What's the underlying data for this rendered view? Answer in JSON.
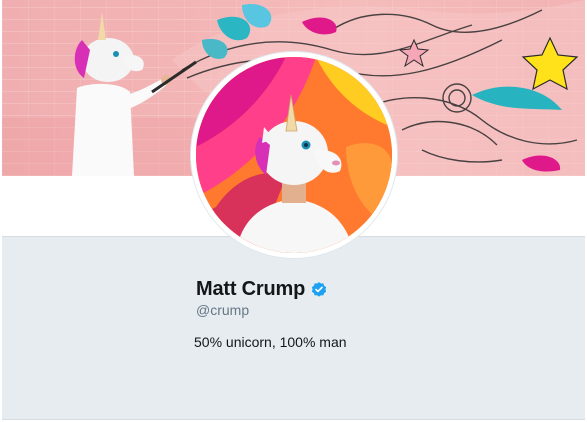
{
  "profile": {
    "name": "Matt Crump",
    "handle": "@crump",
    "bio": "50% unicorn, 100% man",
    "verified": true
  },
  "icons": {
    "verified": "verified-badge-icon"
  },
  "colors": {
    "accent": "#1da1f2",
    "panel": "#e6ecf0",
    "banner_pink": "#f3b5b5",
    "avatar_orange": "#ff7a2e",
    "magenta": "#e0198a"
  }
}
